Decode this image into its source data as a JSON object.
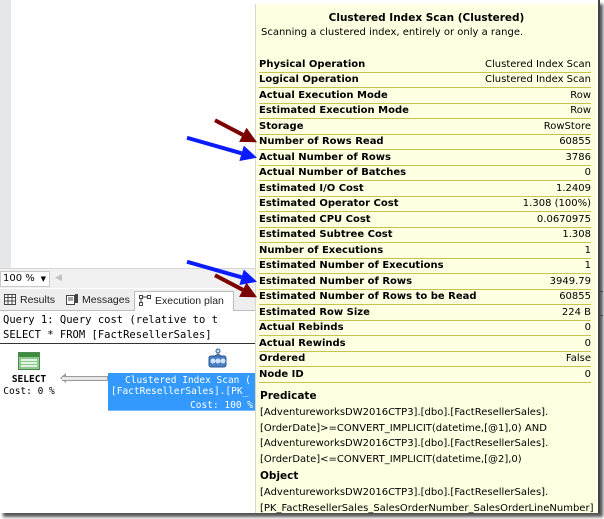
{
  "zoom": {
    "value": "100 %"
  },
  "tabs": [
    {
      "label": "Results",
      "icon": "grid-icon"
    },
    {
      "label": "Messages",
      "icon": "messages-icon"
    },
    {
      "label": "Execution plan",
      "icon": "execution-plan-icon",
      "active": true
    }
  ],
  "query": {
    "line1": "Query 1: Query cost (relative to t",
    "line2": "SELECT * FROM [FactResellerSales]"
  },
  "plan": {
    "select_node": {
      "label": "SELECT",
      "cost": "Cost: 0 %"
    },
    "scan_node": {
      "line1": "Clustered Index Scan (",
      "line2": "[FactResellerSales].[PK_",
      "cost": "Cost: 100 %"
    }
  },
  "tooltip": {
    "title": "Clustered Index Scan (Clustered)",
    "description": "Scanning a clustered index, entirely or only a range.",
    "properties": [
      {
        "key": "Physical Operation",
        "value": "Clustered Index Scan"
      },
      {
        "key": "Logical Operation",
        "value": "Clustered Index Scan"
      },
      {
        "key": "Actual Execution Mode",
        "value": "Row"
      },
      {
        "key": "Estimated Execution Mode",
        "value": "Row"
      },
      {
        "key": "Storage",
        "value": "RowStore"
      },
      {
        "key": "Number of Rows Read",
        "value": "60855"
      },
      {
        "key": "Actual Number of Rows",
        "value": "3786"
      },
      {
        "key": "Actual Number of Batches",
        "value": "0"
      },
      {
        "key": "Estimated I/O Cost",
        "value": "1.2409"
      },
      {
        "key": "Estimated Operator Cost",
        "value": "1.308 (100%)"
      },
      {
        "key": "Estimated CPU Cost",
        "value": "0.0670975"
      },
      {
        "key": "Estimated Subtree Cost",
        "value": "1.308"
      },
      {
        "key": "Number of Executions",
        "value": "1"
      },
      {
        "key": "Estimated Number of Executions",
        "value": "1"
      },
      {
        "key": "Estimated Number of Rows",
        "value": "3949.79"
      },
      {
        "key": "Estimated Number of Rows to be Read",
        "value": "60855"
      },
      {
        "key": "Estimated Row Size",
        "value": "224 B"
      },
      {
        "key": "Actual Rebinds",
        "value": "0"
      },
      {
        "key": "Actual Rewinds",
        "value": "0"
      },
      {
        "key": "Ordered",
        "value": "False"
      },
      {
        "key": "Node ID",
        "value": "0"
      }
    ],
    "predicate_label": "Predicate",
    "predicate_text": "[AdventureworksDW2016CTP3].[dbo].[FactResellerSales].\n[OrderDate]>=CONVERT_IMPLICIT(datetime,[@1],0) AND\n[AdventureworksDW2016CTP3].[dbo].[FactResellerSales].\n[OrderDate]<=CONVERT_IMPLICIT(datetime,[@2],0)",
    "object_label": "Object",
    "object_text": "[AdventureworksDW2016CTP3].[dbo].[FactResellerSales].\n[PK_FactResellerSales_SalesOrderNumber_SalesOrderLineNumber]"
  },
  "annotations": {
    "colors": {
      "dark_red": "#7b0000",
      "blue": "#0a1bff"
    },
    "arrows": [
      {
        "color": "dark_red",
        "points_to": "Number of Rows Read"
      },
      {
        "color": "blue",
        "points_to": "Actual Number of Rows"
      },
      {
        "color": "blue",
        "points_to": "Estimated Number of Rows"
      },
      {
        "color": "dark_red",
        "points_to": "Estimated Number of Rows to be Read"
      }
    ]
  }
}
